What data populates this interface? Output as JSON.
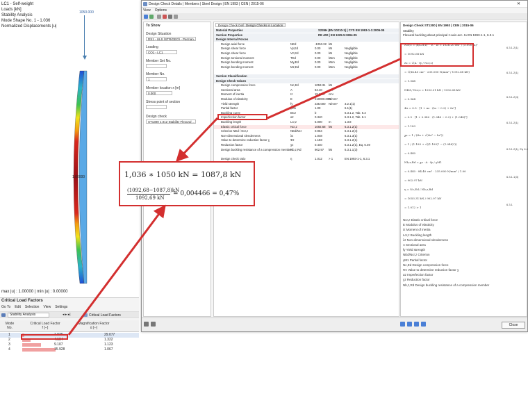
{
  "viewport": {
    "info_lines": [
      "LC1 - Self-weight",
      "Loads [kN]",
      "Stability Analysis",
      "Mode Shape No. 1 - 1.036",
      "Normalized Displacements |u|"
    ],
    "beam_top_label": "1050.000",
    "beam_mid_label": "1.00000",
    "maxmin": "max |u| : 1.00000 | min |u| : 0.00000"
  },
  "clf": {
    "title": "Critical Load Factors",
    "menu": [
      "Go To",
      "Edit",
      "Selection",
      "View",
      "Settings"
    ],
    "toolbar_analysis": "Stability Analysis",
    "toolbar_right_label": "Critical Load Factors",
    "headers": {
      "mode": "Mode\nNo.",
      "clf": "Critical Load Factor\nf [--]",
      "mf": "Magnification Factor\nα [--]"
    },
    "rows": [
      {
        "mode": "1",
        "clf": "1.036",
        "mf": "29.077"
      },
      {
        "mode": "2",
        "clf": "4.104",
        "mf": "1.322"
      },
      {
        "mode": "3",
        "clf": "9.107",
        "mf": "1.123"
      },
      {
        "mode": "4",
        "clf": "15.928",
        "mf": "1.067"
      }
    ]
  },
  "dialog": {
    "title": "Design Check Details | Members | Steel Design | EN 1993 | CEN | 2015-06",
    "menu": [
      "View",
      "Options"
    ],
    "close_label": "Close",
    "tree": {
      "to_show": "To Show",
      "design_situation_label": "Design Situation",
      "design_situation_value": "DS1 - ULS (STR/GEO) - Perman...",
      "loading_label": "Loading",
      "loading_value": "CO1 - LC1",
      "member_set_label": "Member Set No.",
      "member_no_label": "Member No.",
      "member_no_value": "1",
      "member_location_label": "Member location x [m]",
      "member_location_value": "0.000",
      "stress_point_label": "Stress point of section",
      "design_check_label": "Design check",
      "design_check_value": "ST1300 1.012 Stability Flexural ..."
    },
    "mid_tabs": [
      "Design Check Details",
      "Design Checks in Location"
    ],
    "mid_rows": [
      {
        "s": "Material Properties",
        "sec": true,
        "c2": "S235H (EN 10210-1) | CYS EN 1993-1-1:2005-05"
      },
      {
        "s": "Section Properties",
        "sec": true,
        "c2": "RE 400 | EN 1025-5:1994-05"
      },
      {
        "s": "Design Internal Forces",
        "sec": true
      },
      {
        "s": "Design axial force",
        "sym": "NEd",
        "val": "-1053.32",
        "unit": "kN"
      },
      {
        "s": "Design shear force",
        "sym": "Vy,Ed",
        "val": "0.00",
        "unit": "kN",
        "note": "Negligible"
      },
      {
        "s": "Design shear force",
        "sym": "Vz,Ed",
        "val": "0.00",
        "unit": "kN",
        "note": "Negligible"
      },
      {
        "s": "Design torsional moment",
        "sym": "TEd",
        "val": "0.00",
        "unit": "kNm",
        "note": "Negligible"
      },
      {
        "s": "Design bending moment",
        "sym": "My,Ed",
        "val": "0.00",
        "unit": "kNm",
        "note": "Negligible"
      },
      {
        "s": "Design bending moment",
        "sym": "Mz,Ed",
        "val": "0.00",
        "unit": "kNm",
        "note": "Negligible"
      },
      {
        "s": "",
        "sec": false
      },
      {
        "s": "Section Classification",
        "sec": true
      },
      {
        "s": "Design Check Values",
        "sec": true
      },
      {
        "s": "Design compression force",
        "sym": "Nc,Ed",
        "val": "1053.31",
        "unit": "kN"
      },
      {
        "s": "Sectional area",
        "sym": "A",
        "val": "84.40",
        "unit": "cm²"
      },
      {
        "s": "Moment of inertia",
        "sym": "Iz",
        "val": "15.6.80",
        "unit": "cm⁴"
      },
      {
        "s": "Modulus of elasticity",
        "sym": "E",
        "val": "210000.000",
        "unit": "N/mm²"
      },
      {
        "s": "Yield strength",
        "sym": "fy",
        "val": "235.000",
        "unit": "N/mm²",
        "note": "3.2.1(1)"
      },
      {
        "s": "Partial factor",
        "sym": "γM1",
        "val": "1.00",
        "note": "6.1(1)"
      },
      {
        "s": "Buckling curve",
        "sym": "BCz",
        "val": "b",
        "note": "6.3.1.2, Tab. 6.2"
      },
      {
        "s": "Imperfection factor",
        "sym": "αz",
        "val": "0.340",
        "note": "6.3.1.2, Tab. 6.1"
      },
      {
        "s": "Buckling length",
        "sym": "Lcr,z",
        "val": "5.000",
        "unit": "m",
        "note": "1.3.8"
      },
      {
        "s": "Elastic critical force",
        "sym": "Ncr,z",
        "val": "1092.68",
        "unit": "kN",
        "note": "6.3.1.2(1)"
      },
      {
        "s": "Criterion NEd / Ncr,z",
        "sym": "NEd/Ncr",
        "val": "0.964",
        "note": "6.3.1.2(4)"
      },
      {
        "s": "Non-dimensional slenderness",
        "sym": "λz",
        "val": "1.048",
        "note": "6.3.1.3(1)"
      },
      {
        "s": "Value to determine reduction factor χ",
        "sym": "Φz",
        "val": "1.183",
        "note": "6.3.1.2(1)"
      },
      {
        "s": "Reduction factor",
        "sym": "χz",
        "val": "0.440",
        "note": "6.3.1.2(1), Eq. 6.49"
      },
      {
        "s": "Design buckling resistance of a compression member",
        "sym": "Nb,z,Rd",
        "val": "902.97",
        "unit": "kN",
        "note": "6.3.1.1(3)"
      },
      {
        "s": "",
        "sec": false
      },
      {
        "s": "Design check ratio",
        "sym": "η",
        "val": "1.012",
        "unit": "> 1",
        "note": "EN 1993-1-1, 6.3.1"
      }
    ],
    "right": {
      "title": "Design Check ST1300 | EN 1993 | CEN | 2015-06",
      "subtitle1": "Stability",
      "subtitle2": "Flexural buckling about principal z-axis acc. to EN 1993-1-1, 6.3.1",
      "math_lines": [
        "Ncr,z = (π/Lcr,z)² · E · Iz  =  1026.20 cm⁴ / (5.000 m)²",
        "= 1092.68 kN",
        "λz = √(A · fy / Ncr,z)",
        "= √(84.40 cm² · 235.000 N/mm² / 1092.68 kN)",
        "= 1.048",
        "NEd / Ncr,z = 1053.31 kN / 1092.68 kN",
        "= 0.964",
        "Φz = 0.5 · [1 + αz · (λz − 0.2) + λz²]",
        "= 0.5 · [1 + 0.340 · (1.048 − 0.2) + (1.048)²]",
        "= 1.183",
        "χz = 1 / (Φz + √(Φz² − λz²))",
        "= 1 / (1.183 + √((1.183)² − (1.048)²))",
        "= 0.440",
        "Nb,z,Rd = χz · A · fy / γM1",
        "= 0.440 · 84.40 cm² · 235.000 N/mm² / 1.00",
        "= 902.97 kN",
        "η = Nc,Ed / Nb,z,Rd",
        "= 1053.31 kN / 902.97 kN",
        "= 1.012 > 1"
      ],
      "refs": [
        "6.3.1.2(1)",
        "6.3.1.2(1)",
        "6.3.1.2(4)",
        "6.3.1.2(1)",
        "6.3.1.2(1), Eq 6.49",
        "6.3.1.1(3)",
        "6.3.1"
      ],
      "legend": [
        "Ncr,z  Elastic critical force",
        "E  Modulus of elasticity",
        "Iz  Moment of inertia",
        "Lcr,z  Buckling length",
        "λz  Non-dimensional slenderness",
        "A  Sectional area",
        "fy  Yield strength",
        "NEd/Ncr,z  Criterion",
        "γM1  Partial factor",
        "Nc,Ed  Design compression force",
        "Φz  Value to determine reduction factor χ",
        "αz  Imperfection factor",
        "χz  Reduction factor",
        "Nb,z,Rd  Design buckling resistance of a compression member"
      ]
    }
  },
  "calc": {
    "line1": "1,036 ∗ 1050 kN = 1087,8 kN",
    "num": "(1092,68−1087,8)kN",
    "den": "1092,69 kN",
    "result": "= 0,004466 = 0,47%"
  },
  "colors": {
    "accent": "#d32f2f",
    "beam_blue": "#5aa9e6",
    "beam_red": "#c0181d"
  }
}
